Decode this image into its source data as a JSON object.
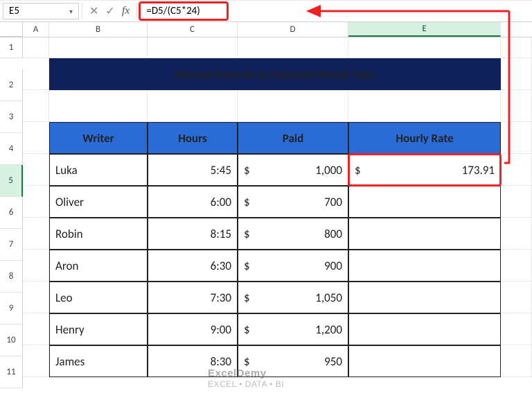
{
  "nameBox": "E5",
  "formulaBar": "=D5/(C5*24)",
  "columns": [
    "A",
    "B",
    "C",
    "D",
    "E"
  ],
  "selectedColumn": "E",
  "rows": [
    "1",
    "2",
    "3",
    "4",
    "5",
    "6",
    "7",
    "8",
    "9",
    "10",
    "11"
  ],
  "selectedRow": "5",
  "title": "Manual Formula to Calculate Hourly Rate",
  "headers": {
    "writer": "Writer",
    "hours": "Hours",
    "paid": "Paid",
    "rate": "Hourly Rate"
  },
  "currencySymbol": "$",
  "table": [
    {
      "writer": "Luka",
      "hours": "5:45",
      "paid": "1,000",
      "rate": "173.91"
    },
    {
      "writer": "Oliver",
      "hours": "6:00",
      "paid": "700",
      "rate": ""
    },
    {
      "writer": "Robin",
      "hours": "8:15",
      "paid": "800",
      "rate": ""
    },
    {
      "writer": "Aron",
      "hours": "6:30",
      "paid": "900",
      "rate": ""
    },
    {
      "writer": "Leo",
      "hours": "7:30",
      "paid": "1,050",
      "rate": ""
    },
    {
      "writer": "Henry",
      "hours": "9:00",
      "paid": "1,200",
      "rate": ""
    },
    {
      "writer": "James",
      "hours": "8:30",
      "paid": "950",
      "rate": ""
    }
  ],
  "watermark": {
    "brand": "ExcelDemy",
    "tag": "EXCEL • DATA • BI"
  },
  "icons": {
    "chevronDown": "▾",
    "cancel": "✕",
    "enter": "✓",
    "fx": "fx"
  },
  "chart_data": {
    "type": "table",
    "title": "Manual Formula to Calculate Hourly Rate",
    "columns": [
      "Writer",
      "Hours",
      "Paid",
      "Hourly Rate"
    ],
    "rows": [
      [
        "Luka",
        "5:45",
        1000,
        173.91
      ],
      [
        "Oliver",
        "6:00",
        700,
        null
      ],
      [
        "Robin",
        "8:15",
        800,
        null
      ],
      [
        "Aron",
        "6:30",
        900,
        null
      ],
      [
        "Leo",
        "7:30",
        1050,
        null
      ],
      [
        "Henry",
        "9:00",
        1200,
        null
      ],
      [
        "James",
        "8:30",
        950,
        null
      ]
    ]
  }
}
